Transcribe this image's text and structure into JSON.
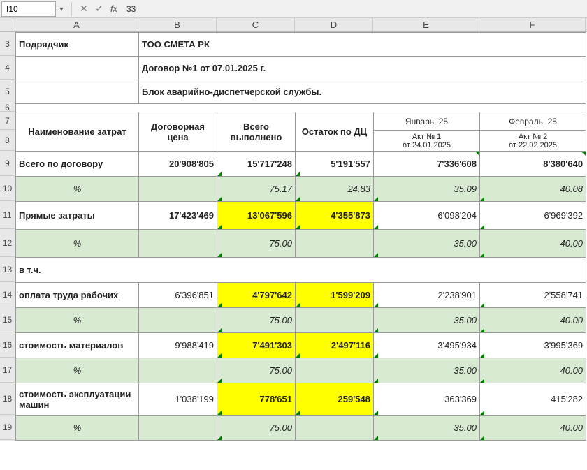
{
  "formula_bar": {
    "name_box": "I10",
    "value": "33"
  },
  "columns": [
    "A",
    "B",
    "C",
    "D",
    "E",
    "F"
  ],
  "rows": [
    "3",
    "4",
    "5",
    "6",
    "7",
    "8",
    "9",
    "10",
    "11",
    "12",
    "13",
    "14",
    "15",
    "16",
    "17",
    "18",
    "19"
  ],
  "info": {
    "contractor_label": "Подрядчик",
    "contractor_value": "ТОО СМЕТА РК",
    "contract_line": "Договор №1 от 07.01.2025 г.",
    "block_line": "Блок аварийно-диспетчерской службы."
  },
  "headers": {
    "name": "Наименование затрат",
    "col_b": "Договорная цена",
    "col_c": "Всего выполнено",
    "col_d": "Остаток по ДЦ",
    "col_e_top": "Январь, 25",
    "col_e_sub1": "Акт № 1",
    "col_e_sub2": "от 24.01.2025",
    "col_f_top": "Февраль, 25",
    "col_f_sub1": "Акт № 2",
    "col_f_sub2": "от 22.02.2025"
  },
  "rows_data": {
    "r9": {
      "a": "Всего по договору",
      "b": "20'908'805",
      "c": "15'717'248",
      "d": "5'191'557",
      "e": "7'336'608",
      "f": "8'380'640"
    },
    "r10": {
      "a": "%",
      "c": "75.17",
      "d": "24.83",
      "e": "35.09",
      "f": "40.08"
    },
    "r11": {
      "a": "Прямые затраты",
      "b": "17'423'469",
      "c": "13'067'596",
      "d": "4'355'873",
      "e": "6'098'204",
      "f": "6'969'392"
    },
    "r12": {
      "a": "%",
      "c": "75.00",
      "e": "35.00",
      "f": "40.00"
    },
    "r13": {
      "a": "в т.ч."
    },
    "r14": {
      "a": "оплата труда рабочих",
      "b": "6'396'851",
      "c": "4'797'642",
      "d": "1'599'209",
      "e": "2'238'901",
      "f": "2'558'741"
    },
    "r15": {
      "a": "%",
      "c": "75.00",
      "e": "35.00",
      "f": "40.00"
    },
    "r16": {
      "a": "стоимость материалов",
      "b": "9'988'419",
      "c": "7'491'303",
      "d": "2'497'116",
      "e": "3'495'934",
      "f": "3'995'369"
    },
    "r17": {
      "a": "%",
      "c": "75.00",
      "e": "35.00",
      "f": "40.00"
    },
    "r18": {
      "a": "стоимость эксплуатации машин",
      "b": "1'038'199",
      "c": "778'651",
      "d": "259'548",
      "e": "363'369",
      "f": "415'282"
    },
    "r19": {
      "a": "%",
      "c": "75.00",
      "e": "35.00",
      "f": "40.00"
    }
  }
}
